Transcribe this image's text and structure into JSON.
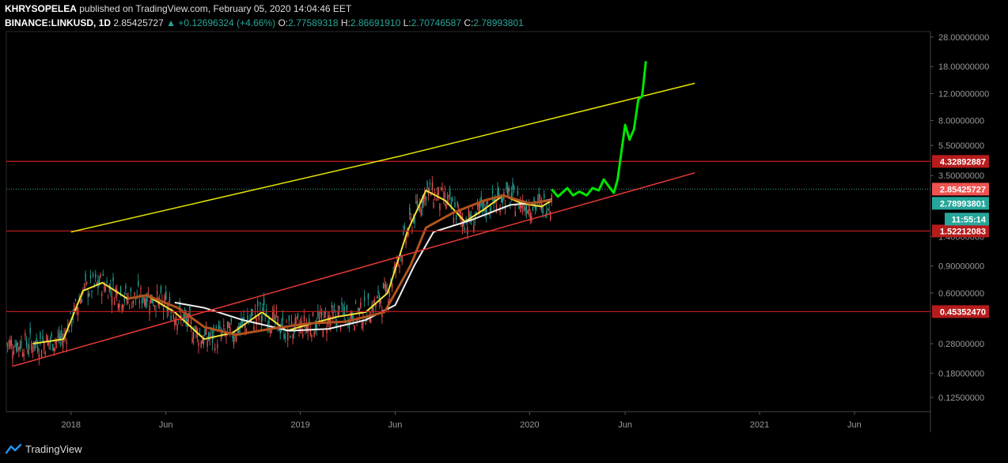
{
  "header": {
    "author": "KHRYSOPELEA",
    "published": "published on TradingView.com, February 05, 2020 14:04:46 EET",
    "symbol": "BINANCE:LINKUSD, 1D",
    "last": "2.85425727",
    "change": "▲ +0.12696324 (+4.66%)",
    "o_label": "O:",
    "o": "2.77589318",
    "h_label": "H:",
    "h": "2.86691910",
    "l_label": "L:",
    "l": "2.70746587",
    "c_label": "C:",
    "c": "2.78993801"
  },
  "footer": {
    "brand": "TradingView"
  },
  "chart_data": {
    "type": "candlestick",
    "y_scale": "log",
    "ylim": [
      0.115,
      28
    ],
    "xlim": [
      "2017-09-20",
      "2021-09-30"
    ],
    "y_ticks": [
      "28.00000000",
      "18.00000000",
      "12.00000000",
      "8.00000000",
      "5.50000000",
      "3.50000000",
      "1.40000000",
      "0.90000000",
      "0.60000000",
      "0.28000000",
      "0.18000000",
      "0.12500000"
    ],
    "y_tick_values": [
      28,
      18,
      12,
      8,
      5.5,
      3.5,
      1.4,
      0.9,
      0.6,
      0.28,
      0.18,
      0.125
    ],
    "x_ticks": [
      {
        "label": "2018",
        "date": "2018-01-01"
      },
      {
        "label": "Jun",
        "date": "2018-06-01"
      },
      {
        "label": "2019",
        "date": "2019-01-01"
      },
      {
        "label": "Jun",
        "date": "2019-06-01"
      },
      {
        "label": "2020",
        "date": "2020-01-01"
      },
      {
        "label": "Jun",
        "date": "2020-06-01"
      },
      {
        "label": "2021",
        "date": "2021-01-01"
      },
      {
        "label": "Jun",
        "date": "2021-06-01"
      }
    ],
    "horizontal_levels": [
      {
        "value": 4.32892887,
        "label": "4.32892887",
        "color": "#b71c1c"
      },
      {
        "value": 1.52212083,
        "label": "1.52212083",
        "color": "#b71c1c"
      },
      {
        "value": 0.4535247,
        "label": "0.45352470",
        "color": "#b71c1c"
      }
    ],
    "last_price": {
      "value": 2.85425727,
      "label": "2.85425727",
      "color": "#ef5350"
    },
    "close_price": {
      "value": 2.78993801,
      "label": "2.78993801",
      "color": "#26a69a"
    },
    "countdown": {
      "label": "11:55:14",
      "color": "#26a69a"
    },
    "trendlines": [
      {
        "name": "",
        "color": "#e6e600",
        "points": [
          [
            "2018-01-01",
            1.5
          ],
          [
            "2019-06-10",
            4.7
          ],
          [
            "2020-09-20",
            14.0
          ]
        ]
      },
      {
        "name": "",
        "color": "#e53935",
        "points": [
          [
            "2017-10-01",
            0.2
          ],
          [
            "2020-09-20",
            3.65
          ]
        ]
      }
    ],
    "projection": {
      "color": "#00e600",
      "points": [
        [
          "2020-02-05",
          2.85
        ],
        [
          "2020-02-15",
          2.55
        ],
        [
          "2020-03-01",
          2.9
        ],
        [
          "2020-03-10",
          2.6
        ],
        [
          "2020-03-20",
          2.75
        ],
        [
          "2020-04-01",
          2.6
        ],
        [
          "2020-04-10",
          2.9
        ],
        [
          "2020-04-20",
          2.8
        ],
        [
          "2020-04-28",
          3.3
        ],
        [
          "2020-05-08",
          2.9
        ],
        [
          "2020-05-14",
          2.7
        ],
        [
          "2020-05-20",
          3.3
        ],
        [
          "2020-06-01",
          7.5
        ],
        [
          "2020-06-08",
          6.0
        ],
        [
          "2020-06-15",
          7.0
        ],
        [
          "2020-06-22",
          11.0
        ],
        [
          "2020-06-28",
          11.5
        ],
        [
          "2020-07-04",
          19.5
        ]
      ]
    },
    "moving_averages": [
      {
        "name": "",
        "color": "#f2e33a",
        "width": 2,
        "points": [
          [
            "2017-11-01",
            0.28
          ],
          [
            "2017-12-20",
            0.3
          ],
          [
            "2018-01-20",
            0.62
          ],
          [
            "2018-02-20",
            0.7
          ],
          [
            "2018-04-01",
            0.55
          ],
          [
            "2018-05-01",
            0.58
          ],
          [
            "2018-06-15",
            0.45
          ],
          [
            "2018-08-01",
            0.3
          ],
          [
            "2018-09-15",
            0.33
          ],
          [
            "2018-11-01",
            0.45
          ],
          [
            "2018-12-10",
            0.34
          ],
          [
            "2019-01-20",
            0.38
          ],
          [
            "2019-03-01",
            0.42
          ],
          [
            "2019-04-15",
            0.45
          ],
          [
            "2019-05-20",
            0.6
          ],
          [
            "2019-06-20",
            1.5
          ],
          [
            "2019-07-20",
            2.8
          ],
          [
            "2019-08-20",
            2.4
          ],
          [
            "2019-09-20",
            1.75
          ],
          [
            "2019-10-20",
            2.1
          ],
          [
            "2019-11-20",
            2.6
          ],
          [
            "2019-12-20",
            2.3
          ],
          [
            "2020-01-20",
            2.2
          ],
          [
            "2020-02-05",
            2.4
          ]
        ]
      },
      {
        "name": "",
        "color": "#f0f0f0",
        "width": 2,
        "points": [
          [
            "2018-06-15",
            0.52
          ],
          [
            "2018-08-01",
            0.48
          ],
          [
            "2018-10-01",
            0.4
          ],
          [
            "2018-12-15",
            0.34
          ],
          [
            "2019-02-15",
            0.35
          ],
          [
            "2019-04-15",
            0.4
          ],
          [
            "2019-06-01",
            0.5
          ],
          [
            "2019-07-01",
            0.9
          ],
          [
            "2019-08-01",
            1.5
          ],
          [
            "2019-10-01",
            1.8
          ],
          [
            "2019-12-01",
            2.25
          ],
          [
            "2020-01-15",
            2.35
          ],
          [
            "2020-02-05",
            2.45
          ]
        ]
      },
      {
        "name": "",
        "color": "#b0521e",
        "width": 3,
        "points": [
          [
            "2018-04-01",
            0.55
          ],
          [
            "2018-05-01",
            0.58
          ],
          [
            "2018-06-20",
            0.48
          ],
          [
            "2018-08-01",
            0.36
          ],
          [
            "2018-09-20",
            0.32
          ],
          [
            "2018-11-15",
            0.35
          ],
          [
            "2019-01-15",
            0.38
          ],
          [
            "2019-03-15",
            0.39
          ],
          [
            "2019-05-15",
            0.45
          ],
          [
            "2019-06-25",
            0.9
          ],
          [
            "2019-07-20",
            1.6
          ],
          [
            "2019-09-01",
            2.0
          ],
          [
            "2019-10-20",
            2.4
          ],
          [
            "2019-11-20",
            2.6
          ],
          [
            "2020-01-01",
            2.3
          ],
          [
            "2020-02-05",
            2.42
          ]
        ]
      }
    ]
  }
}
